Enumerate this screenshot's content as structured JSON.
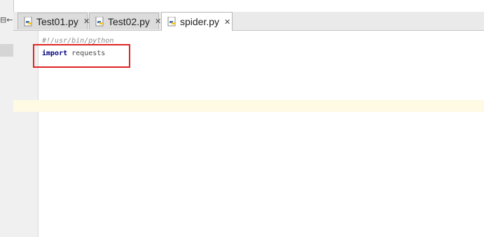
{
  "tabs": [
    {
      "label": "Test01.py",
      "icon": "python-file-icon",
      "active": false
    },
    {
      "label": "Test02.py",
      "icon": "python-file-icon",
      "active": false
    },
    {
      "label": "spider.py",
      "icon": "python-file-icon",
      "active": true
    }
  ],
  "close_glyph": "✕",
  "collapse_glyph": "⊟←",
  "editor": {
    "lines": [
      {
        "text": "#!/usr/bin/python"
      },
      {
        "keyword": "import",
        "rest": " requests"
      }
    ]
  },
  "colors": {
    "highlight_box": "#e02424",
    "caret_line": "#fffae3",
    "keyword": "#000080"
  }
}
